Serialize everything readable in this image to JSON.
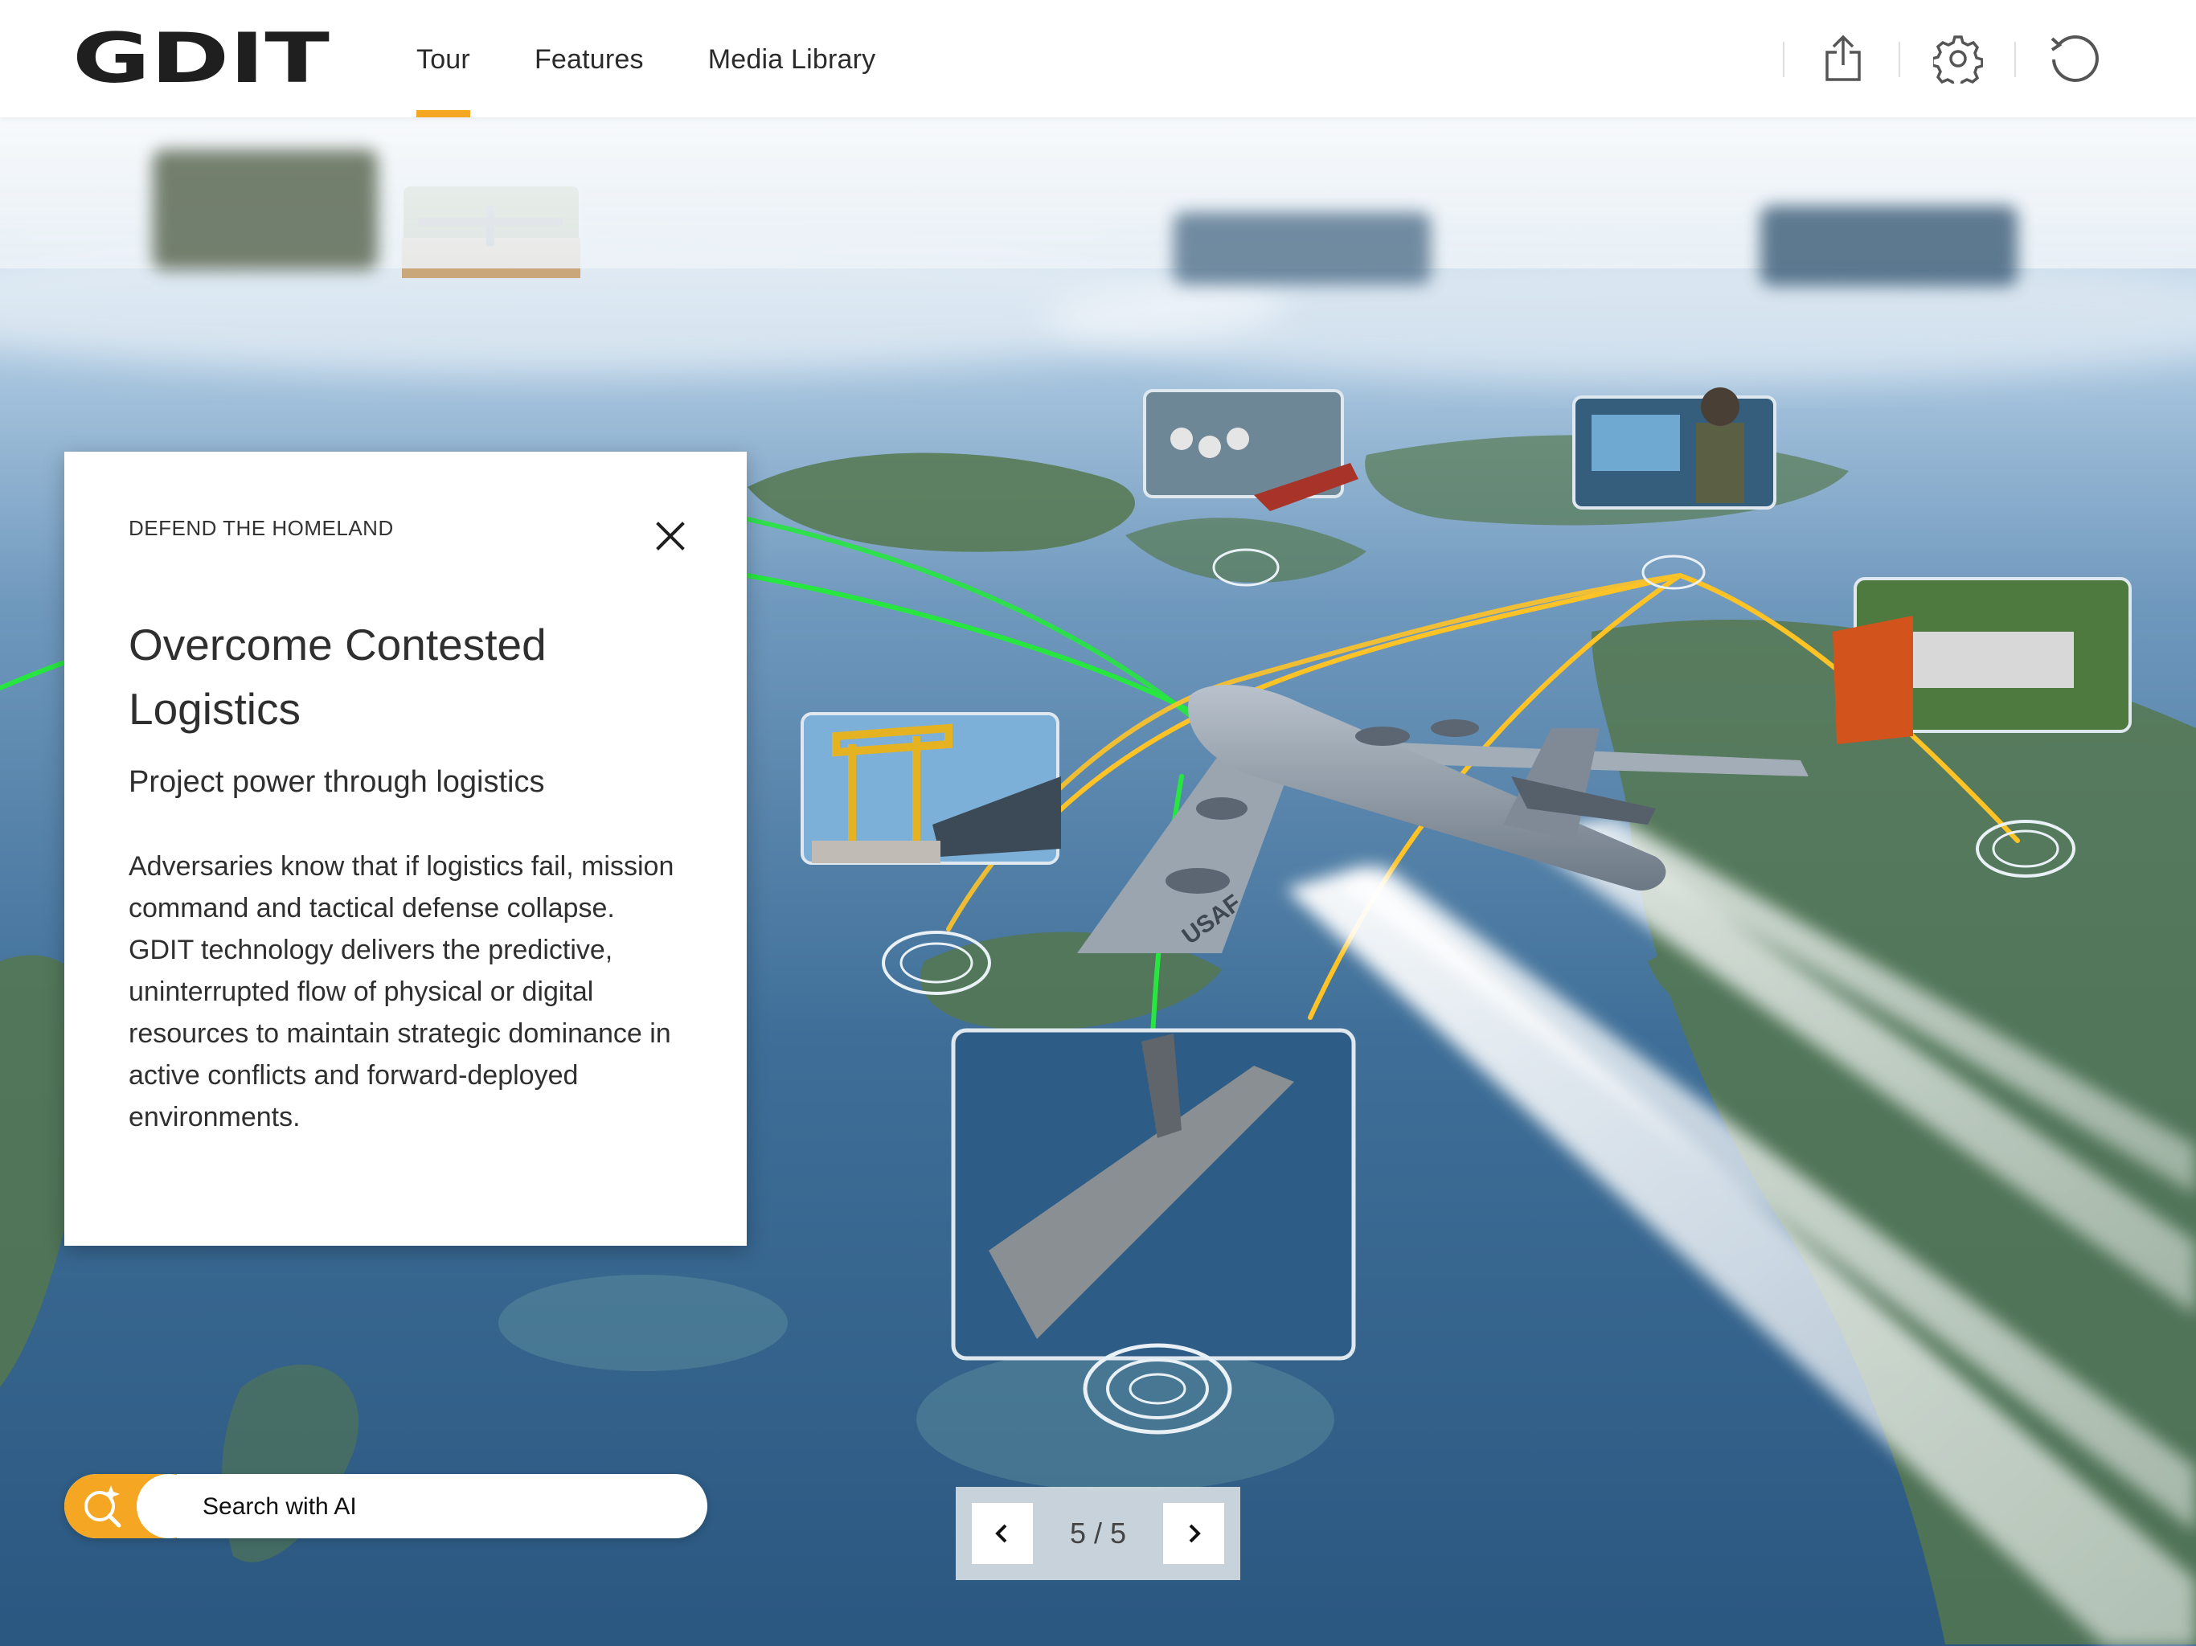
{
  "brand": {
    "logo_text": "GDIT"
  },
  "nav": {
    "items": [
      {
        "label": "Tour",
        "active": true
      },
      {
        "label": "Features",
        "active": false
      },
      {
        "label": "Media Library",
        "active": false
      }
    ]
  },
  "toolbar": {
    "icons": [
      "share-icon",
      "gear-icon",
      "reset-icon"
    ]
  },
  "panel": {
    "eyebrow": "DEFEND THE HOMELAND",
    "title": "Overcome Contested Logistics",
    "subtitle": "Project power through logistics",
    "body": [
      "Adversaries know that if logistics fail, mission command and tactical defense collapse.",
      "GDIT technology delivers the predictive, uninterrupted flow of physical or digital resources to maintain strategic dominance in active conflicts and forward-deployed environments."
    ]
  },
  "aircraft_label": "USAF",
  "search": {
    "placeholder": "Search with AI"
  },
  "pager": {
    "current": 5,
    "total": 5,
    "display": "5 / 5"
  },
  "colors": {
    "accent": "#f5a623",
    "route_green": "#27e640",
    "route_orange": "#ffc326",
    "header_bg": "#ffffff",
    "panel_bg": "#ffffff"
  }
}
